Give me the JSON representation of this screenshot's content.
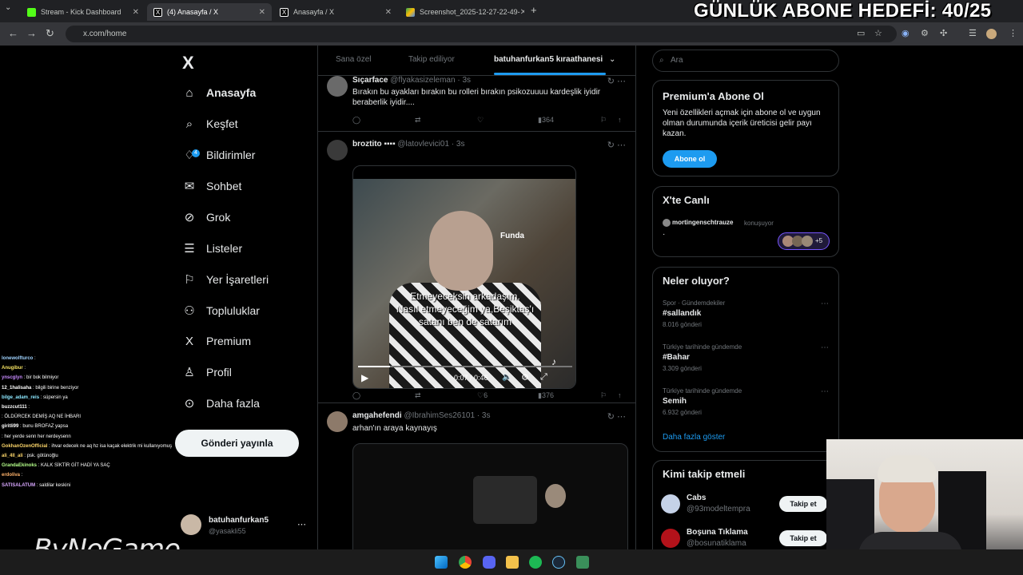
{
  "browser": {
    "tabs": [
      {
        "label": "Stream - Kick Dashboard",
        "active": false
      },
      {
        "label": "(4) Anasayfa / X",
        "active": true
      },
      {
        "label": "Anasayfa / X",
        "active": false
      },
      {
        "label": "Screenshot_2025-12-27-22-49-",
        "active": false
      }
    ],
    "url": "x.com/home"
  },
  "overlay": {
    "goal": "GÜNLÜK ABONE HEDEFİ: 40/25",
    "watermark": "ByNoGame"
  },
  "sidebar": {
    "items": [
      {
        "label": "Anasayfa",
        "icon": "home-icon"
      },
      {
        "label": "Keşfet",
        "icon": "search-icon"
      },
      {
        "label": "Bildirimler",
        "icon": "bell-icon",
        "badge": "4"
      },
      {
        "label": "Sohbet",
        "icon": "mail-icon"
      },
      {
        "label": "Grok",
        "icon": "grok-icon"
      },
      {
        "label": "Listeler",
        "icon": "list-icon"
      },
      {
        "label": "Yer İşaretleri",
        "icon": "bookmark-icon"
      },
      {
        "label": "Topluluklar",
        "icon": "community-icon"
      },
      {
        "label": "Premium",
        "icon": "x-logo-icon"
      },
      {
        "label": "Profil",
        "icon": "person-icon"
      },
      {
        "label": "Daha fazla",
        "icon": "more-icon"
      }
    ],
    "post_button": "Gönderi yayınla",
    "account": {
      "name": "batuhanfurkan5",
      "handle": "@yasakli55"
    }
  },
  "timeline": {
    "tabs": [
      "Sana özel",
      "Takip ediliyor",
      "batuhanfurkan5 kıraathanesi"
    ],
    "tweets": [
      {
        "name": "Sıçarface",
        "handle": "@flyakasizeleman · 3s",
        "text": "Bırakın bu ayakları bırakın bu rolleri bırakın psikozuuuu kardeşlik iyidir beraberlik iyidir....",
        "likes": "",
        "views": "364"
      },
      {
        "name": "broztito",
        "handle": "@latovlevici01 · 3s",
        "text": "",
        "likes": "6",
        "views": "376",
        "video": {
          "time": "0:07 / 0:46",
          "sub1": "Etmeyeceksin arkadaşım.",
          "sub2": "Nasıl etmeyeceğim ya,Beşiktaş'ı",
          "sub3": "satanı ben de satarım",
          "tag": "Funda",
          "progress": 0.15
        }
      },
      {
        "name": "amgahefendi",
        "handle": "@IbrahimSes26101 · 3s",
        "text": "arhan'ın araya kaynayış"
      }
    ]
  },
  "right": {
    "search_placeholder": "Ara",
    "premium": {
      "title": "Premium'a Abone Ol",
      "text": "Yeni özellikleri açmak için abone ol ve uygun olman durumunda içerik üreticisi gelir payı kazan.",
      "button": "Abone ol"
    },
    "live": {
      "title": "X'te Canlı",
      "host": "mortingenschtrauze",
      "status": "konuşuyor",
      "extra": "+5"
    },
    "trends": {
      "title": "Neler oluyor?",
      "items": [
        {
          "meta": "Spor · Gündemdekiler",
          "name": "#sallandık",
          "count": "8.016 gönderi"
        },
        {
          "meta": "Türkiye tarihinde gündemde",
          "name": "#Bahar",
          "count": "3.309 gönderi"
        },
        {
          "meta": "Türkiye tarihinde gündemde",
          "name": "Semih",
          "count": "6.932 gönderi"
        }
      ],
      "more": "Daha fazla göster"
    },
    "follow": {
      "title": "Kimi takip etmeli",
      "items": [
        {
          "name": "Cabs",
          "handle": "@93modeltempra",
          "button": "Takip et"
        },
        {
          "name": "Boşuna Tıklama",
          "handle": "@bosunatiklama",
          "button": "Takip et"
        }
      ]
    }
  },
  "chat": [
    {
      "user": "lonewolfturco",
      "msg": "",
      "color": "#9fd3ff"
    },
    {
      "user": "Anugibur",
      "msg": "",
      "color": "#f7e463"
    },
    {
      "user": "ynscglyn",
      "msg": "bir bok bilmiyor",
      "color": "#c88bff"
    },
    {
      "user": "12_1halisaha",
      "msg": "bilgili birine benziyor",
      "color": "#ffffff"
    },
    {
      "user": "bilge_adam_reis",
      "msg": "süpersin ya",
      "color": "#8ce8ff"
    },
    {
      "user": "buzzcut111",
      "msg": "",
      "color": "#ffffff"
    },
    {
      "user": "",
      "msg": "ÖLDÜRCEK DEMİŞ AQ NE İHBARI",
      "color": "#ff6b6b"
    },
    {
      "user": "giritli99",
      "msg": "bunu BROFAZ yapsa",
      "color": "#ffffff"
    },
    {
      "user": "",
      "msg": "her yerde senn her nerdeysenn",
      "color": "#ff5b5b"
    },
    {
      "user": "GokhanOzenOfficial",
      "msg": "ihvar edecek ne aq hz isa kaçak elektrik mi kullanıyomuş",
      "color": "#ffd86b"
    },
    {
      "user": "ali_4ll_ali",
      "msg": "psk. götünoğlu",
      "color": "#ffd86b"
    },
    {
      "user": "GrandaEkinoks",
      "msg": "KALK SİKTİR GİT HADİ YA SAÇ",
      "color": "#b5ff8a"
    },
    {
      "user": "erdoliva",
      "msg": "",
      "color": "#ffb36b"
    },
    {
      "user": "SATISALATUM",
      "msg": "saldilar keskini",
      "color": "#d8a7ff"
    }
  ]
}
